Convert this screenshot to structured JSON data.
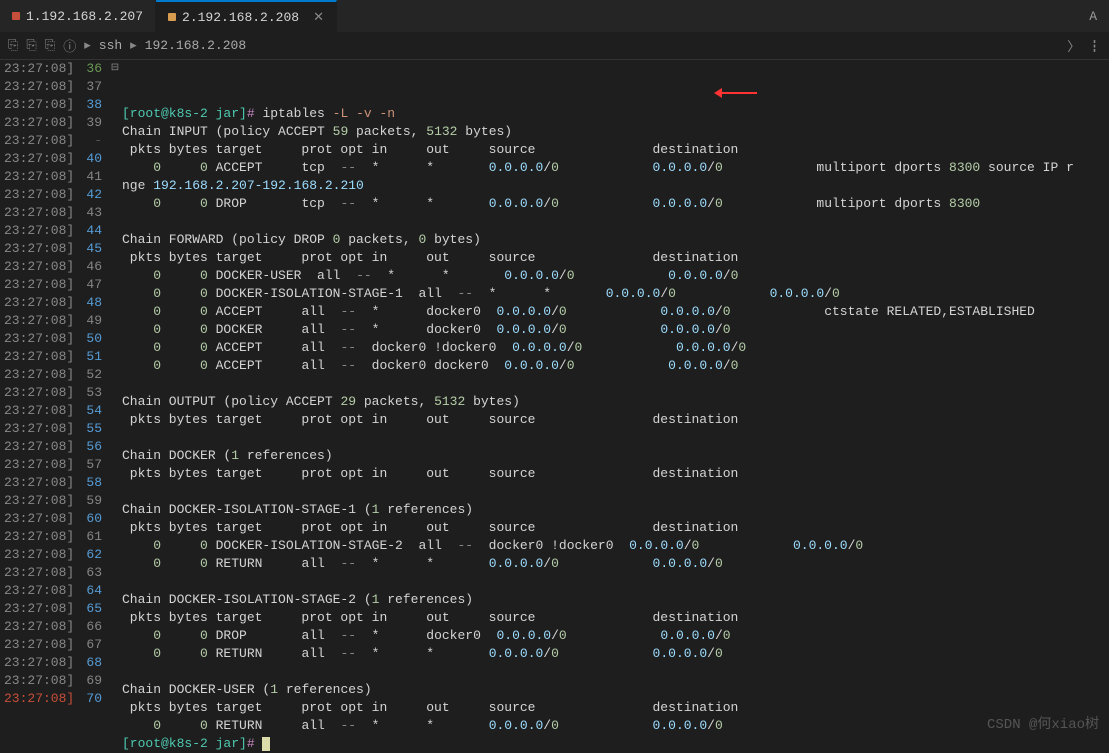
{
  "tabs": [
    {
      "label": "1.192.168.2.207",
      "active": false,
      "dot": "red"
    },
    {
      "label": "2.192.168.2.208",
      "active": true,
      "dot": "orange"
    }
  ],
  "tabLetter": "A",
  "breadcrumb": {
    "p1": "ssh",
    "p2": "192.168.2.208"
  },
  "watermark": "CSDN @何xiao树",
  "lines": [
    {
      "ts": "23:27:08]",
      "n": 36,
      "nc": "green",
      "fold": "⊟",
      "seg": [
        [
          "prompt",
          "[root@k8s-2 jar]# "
        ],
        [
          "white",
          "iptables "
        ],
        [
          "red",
          "-L -v -n"
        ]
      ]
    },
    {
      "ts": "23:27:08]",
      "n": 37,
      "seg": [
        [
          "white",
          "Chain INPUT (policy ACCEPT "
        ],
        [
          "num",
          "59"
        ],
        [
          "white",
          " packets, "
        ],
        [
          "num",
          "5132"
        ],
        [
          "white",
          " bytes)"
        ]
      ]
    },
    {
      "ts": "23:27:08]",
      "n": 38,
      "nc": "blue",
      "seg": [
        [
          "white",
          " pkts bytes target     prot opt in     out     source               destination"
        ]
      ]
    },
    {
      "ts": "23:27:08]",
      "n": 39,
      "seg": [
        [
          "zero",
          "    0     0"
        ],
        [
          "white",
          " ACCEPT     tcp  "
        ],
        [
          "grey",
          "--"
        ],
        [
          "white",
          "  *      *       "
        ],
        [
          "ip",
          "0.0.0.0"
        ],
        [
          "white",
          "/"
        ],
        [
          "num",
          "0"
        ],
        [
          "white",
          "            "
        ],
        [
          "ip",
          "0.0.0.0"
        ],
        [
          "white",
          "/"
        ],
        [
          "num",
          "0"
        ],
        [
          "white",
          "            multiport dports "
        ],
        [
          "num",
          "8300"
        ],
        [
          "white",
          " source IP r"
        ]
      ]
    },
    {
      "ts": "23:27:08]",
      "n": "-",
      "nc": "grey",
      "seg": [
        [
          "white",
          "nge "
        ],
        [
          "ip",
          "192.168.2.207-192.168.2.210"
        ]
      ]
    },
    {
      "ts": "23:27:08]",
      "n": 40,
      "nc": "blue",
      "seg": [
        [
          "zero",
          "    0     0"
        ],
        [
          "white",
          " DROP       tcp  "
        ],
        [
          "grey",
          "--"
        ],
        [
          "white",
          "  *      *       "
        ],
        [
          "ip",
          "0.0.0.0"
        ],
        [
          "white",
          "/"
        ],
        [
          "num",
          "0"
        ],
        [
          "white",
          "            "
        ],
        [
          "ip",
          "0.0.0.0"
        ],
        [
          "white",
          "/"
        ],
        [
          "num",
          "0"
        ],
        [
          "white",
          "            multiport dports "
        ],
        [
          "num",
          "8300"
        ]
      ]
    },
    {
      "ts": "23:27:08]",
      "n": 41,
      "seg": [
        [
          "white",
          ""
        ]
      ]
    },
    {
      "ts": "23:27:08]",
      "n": 42,
      "nc": "blue",
      "seg": [
        [
          "white",
          "Chain FORWARD (policy DROP "
        ],
        [
          "num",
          "0"
        ],
        [
          "white",
          " packets, "
        ],
        [
          "num",
          "0"
        ],
        [
          "white",
          " bytes)"
        ]
      ]
    },
    {
      "ts": "23:27:08]",
      "n": 43,
      "seg": [
        [
          "white",
          " pkts bytes target     prot opt in     out     source               destination"
        ]
      ]
    },
    {
      "ts": "23:27:08]",
      "n": 44,
      "nc": "blue",
      "seg": [
        [
          "zero",
          "    0     0"
        ],
        [
          "white",
          " DOCKER-USER  all  "
        ],
        [
          "grey",
          "--"
        ],
        [
          "white",
          "  *      *       "
        ],
        [
          "ip",
          "0.0.0.0"
        ],
        [
          "white",
          "/"
        ],
        [
          "num",
          "0"
        ],
        [
          "white",
          "            "
        ],
        [
          "ip",
          "0.0.0.0"
        ],
        [
          "white",
          "/"
        ],
        [
          "num",
          "0"
        ]
      ]
    },
    {
      "ts": "23:27:08]",
      "n": 45,
      "nc": "blue",
      "seg": [
        [
          "zero",
          "    0     0"
        ],
        [
          "white",
          " DOCKER-ISOLATION-STAGE-1  all  "
        ],
        [
          "grey",
          "--"
        ],
        [
          "white",
          "  *      *       "
        ],
        [
          "ip",
          "0.0.0.0"
        ],
        [
          "white",
          "/"
        ],
        [
          "num",
          "0"
        ],
        [
          "white",
          "            "
        ],
        [
          "ip",
          "0.0.0.0"
        ],
        [
          "white",
          "/"
        ],
        [
          "num",
          "0"
        ]
      ]
    },
    {
      "ts": "23:27:08]",
      "n": 46,
      "seg": [
        [
          "zero",
          "    0     0"
        ],
        [
          "white",
          " ACCEPT     all  "
        ],
        [
          "grey",
          "--"
        ],
        [
          "white",
          "  *      docker0  "
        ],
        [
          "ip",
          "0.0.0.0"
        ],
        [
          "white",
          "/"
        ],
        [
          "num",
          "0"
        ],
        [
          "white",
          "            "
        ],
        [
          "ip",
          "0.0.0.0"
        ],
        [
          "white",
          "/"
        ],
        [
          "num",
          "0"
        ],
        [
          "white",
          "            ctstate RELATED,ESTABLISHED"
        ]
      ]
    },
    {
      "ts": "23:27:08]",
      "n": 47,
      "seg": [
        [
          "zero",
          "    0     0"
        ],
        [
          "white",
          " DOCKER     all  "
        ],
        [
          "grey",
          "--"
        ],
        [
          "white",
          "  *      docker0  "
        ],
        [
          "ip",
          "0.0.0.0"
        ],
        [
          "white",
          "/"
        ],
        [
          "num",
          "0"
        ],
        [
          "white",
          "            "
        ],
        [
          "ip",
          "0.0.0.0"
        ],
        [
          "white",
          "/"
        ],
        [
          "num",
          "0"
        ]
      ]
    },
    {
      "ts": "23:27:08]",
      "n": 48,
      "nc": "blue",
      "seg": [
        [
          "zero",
          "    0     0"
        ],
        [
          "white",
          " ACCEPT     all  "
        ],
        [
          "grey",
          "--"
        ],
        [
          "white",
          "  docker0 !docker0  "
        ],
        [
          "ip",
          "0.0.0.0"
        ],
        [
          "white",
          "/"
        ],
        [
          "num",
          "0"
        ],
        [
          "white",
          "            "
        ],
        [
          "ip",
          "0.0.0.0"
        ],
        [
          "white",
          "/"
        ],
        [
          "num",
          "0"
        ]
      ]
    },
    {
      "ts": "23:27:08]",
      "n": 49,
      "seg": [
        [
          "zero",
          "    0     0"
        ],
        [
          "white",
          " ACCEPT     all  "
        ],
        [
          "grey",
          "--"
        ],
        [
          "white",
          "  docker0 docker0  "
        ],
        [
          "ip",
          "0.0.0.0"
        ],
        [
          "white",
          "/"
        ],
        [
          "num",
          "0"
        ],
        [
          "white",
          "            "
        ],
        [
          "ip",
          "0.0.0.0"
        ],
        [
          "white",
          "/"
        ],
        [
          "num",
          "0"
        ]
      ]
    },
    {
      "ts": "23:27:08]",
      "n": 50,
      "nc": "blue",
      "seg": [
        [
          "white",
          ""
        ]
      ]
    },
    {
      "ts": "23:27:08]",
      "n": 51,
      "nc": "blue",
      "seg": [
        [
          "white",
          "Chain OUTPUT (policy ACCEPT "
        ],
        [
          "num",
          "29"
        ],
        [
          "white",
          " packets, "
        ],
        [
          "num",
          "5132"
        ],
        [
          "white",
          " bytes)"
        ]
      ]
    },
    {
      "ts": "23:27:08]",
      "n": 52,
      "seg": [
        [
          "white",
          " pkts bytes target     prot opt in     out     source               destination"
        ]
      ]
    },
    {
      "ts": "23:27:08]",
      "n": 53,
      "seg": [
        [
          "white",
          ""
        ]
      ]
    },
    {
      "ts": "23:27:08]",
      "n": 54,
      "nc": "blue",
      "seg": [
        [
          "white",
          "Chain DOCKER ("
        ],
        [
          "num",
          "1"
        ],
        [
          "white",
          " references)"
        ]
      ]
    },
    {
      "ts": "23:27:08]",
      "n": 55,
      "nc": "blue",
      "seg": [
        [
          "white",
          " pkts bytes target     prot opt in     out     source               destination"
        ]
      ]
    },
    {
      "ts": "23:27:08]",
      "n": 56,
      "nc": "blue",
      "seg": [
        [
          "white",
          ""
        ]
      ]
    },
    {
      "ts": "23:27:08]",
      "n": 57,
      "seg": [
        [
          "white",
          "Chain DOCKER-ISOLATION-STAGE-1 ("
        ],
        [
          "num",
          "1"
        ],
        [
          "white",
          " references)"
        ]
      ]
    },
    {
      "ts": "23:27:08]",
      "n": 58,
      "nc": "blue",
      "seg": [
        [
          "white",
          " pkts bytes target     prot opt in     out     source               destination"
        ]
      ]
    },
    {
      "ts": "23:27:08]",
      "n": 59,
      "seg": [
        [
          "zero",
          "    0     0"
        ],
        [
          "white",
          " DOCKER-ISOLATION-STAGE-2  all  "
        ],
        [
          "grey",
          "--"
        ],
        [
          "white",
          "  docker0 !docker0  "
        ],
        [
          "ip",
          "0.0.0.0"
        ],
        [
          "white",
          "/"
        ],
        [
          "num",
          "0"
        ],
        [
          "white",
          "            "
        ],
        [
          "ip",
          "0.0.0.0"
        ],
        [
          "white",
          "/"
        ],
        [
          "num",
          "0"
        ]
      ]
    },
    {
      "ts": "23:27:08]",
      "n": 60,
      "nc": "blue",
      "seg": [
        [
          "zero",
          "    0     0"
        ],
        [
          "white",
          " RETURN     all  "
        ],
        [
          "grey",
          "--"
        ],
        [
          "white",
          "  *      *       "
        ],
        [
          "ip",
          "0.0.0.0"
        ],
        [
          "white",
          "/"
        ],
        [
          "num",
          "0"
        ],
        [
          "white",
          "            "
        ],
        [
          "ip",
          "0.0.0.0"
        ],
        [
          "white",
          "/"
        ],
        [
          "num",
          "0"
        ]
      ]
    },
    {
      "ts": "23:27:08]",
      "n": 61,
      "seg": [
        [
          "white",
          ""
        ]
      ]
    },
    {
      "ts": "23:27:08]",
      "n": 62,
      "nc": "blue",
      "seg": [
        [
          "white",
          "Chain DOCKER-ISOLATION-STAGE-2 ("
        ],
        [
          "num",
          "1"
        ],
        [
          "white",
          " references)"
        ]
      ]
    },
    {
      "ts": "23:27:08]",
      "n": 63,
      "seg": [
        [
          "white",
          " pkts bytes target     prot opt in     out     source               destination"
        ]
      ]
    },
    {
      "ts": "23:27:08]",
      "n": 64,
      "nc": "blue",
      "seg": [
        [
          "zero",
          "    0     0"
        ],
        [
          "white",
          " DROP       all  "
        ],
        [
          "grey",
          "--"
        ],
        [
          "white",
          "  *      docker0  "
        ],
        [
          "ip",
          "0.0.0.0"
        ],
        [
          "white",
          "/"
        ],
        [
          "num",
          "0"
        ],
        [
          "white",
          "            "
        ],
        [
          "ip",
          "0.0.0.0"
        ],
        [
          "white",
          "/"
        ],
        [
          "num",
          "0"
        ]
      ]
    },
    {
      "ts": "23:27:08]",
      "n": 65,
      "nc": "blue",
      "seg": [
        [
          "zero",
          "    0     0"
        ],
        [
          "white",
          " RETURN     all  "
        ],
        [
          "grey",
          "--"
        ],
        [
          "white",
          "  *      *       "
        ],
        [
          "ip",
          "0.0.0.0"
        ],
        [
          "white",
          "/"
        ],
        [
          "num",
          "0"
        ],
        [
          "white",
          "            "
        ],
        [
          "ip",
          "0.0.0.0"
        ],
        [
          "white",
          "/"
        ],
        [
          "num",
          "0"
        ]
      ]
    },
    {
      "ts": "23:27:08]",
      "n": 66,
      "seg": [
        [
          "white",
          ""
        ]
      ]
    },
    {
      "ts": "23:27:08]",
      "n": 67,
      "seg": [
        [
          "white",
          "Chain DOCKER-USER ("
        ],
        [
          "num",
          "1"
        ],
        [
          "white",
          " references)"
        ]
      ]
    },
    {
      "ts": "23:27:08]",
      "n": 68,
      "nc": "blue",
      "seg": [
        [
          "white",
          " pkts bytes target     prot opt in     out     source               destination"
        ]
      ]
    },
    {
      "ts": "23:27:08]",
      "n": 69,
      "seg": [
        [
          "zero",
          "    0     0"
        ],
        [
          "white",
          " RETURN     all  "
        ],
        [
          "grey",
          "--"
        ],
        [
          "white",
          "  *      *       "
        ],
        [
          "ip",
          "0.0.0.0"
        ],
        [
          "white",
          "/"
        ],
        [
          "num",
          "0"
        ],
        [
          "white",
          "            "
        ],
        [
          "ip",
          "0.0.0.0"
        ],
        [
          "white",
          "/"
        ],
        [
          "num",
          "0"
        ]
      ]
    },
    {
      "ts": "23:27:08]",
      "n": 70,
      "nc": "blue",
      "tshi": true,
      "seg": [
        [
          "prompt",
          "[root@k8s-2 jar]# "
        ],
        [
          "cursor",
          ""
        ]
      ]
    }
  ]
}
